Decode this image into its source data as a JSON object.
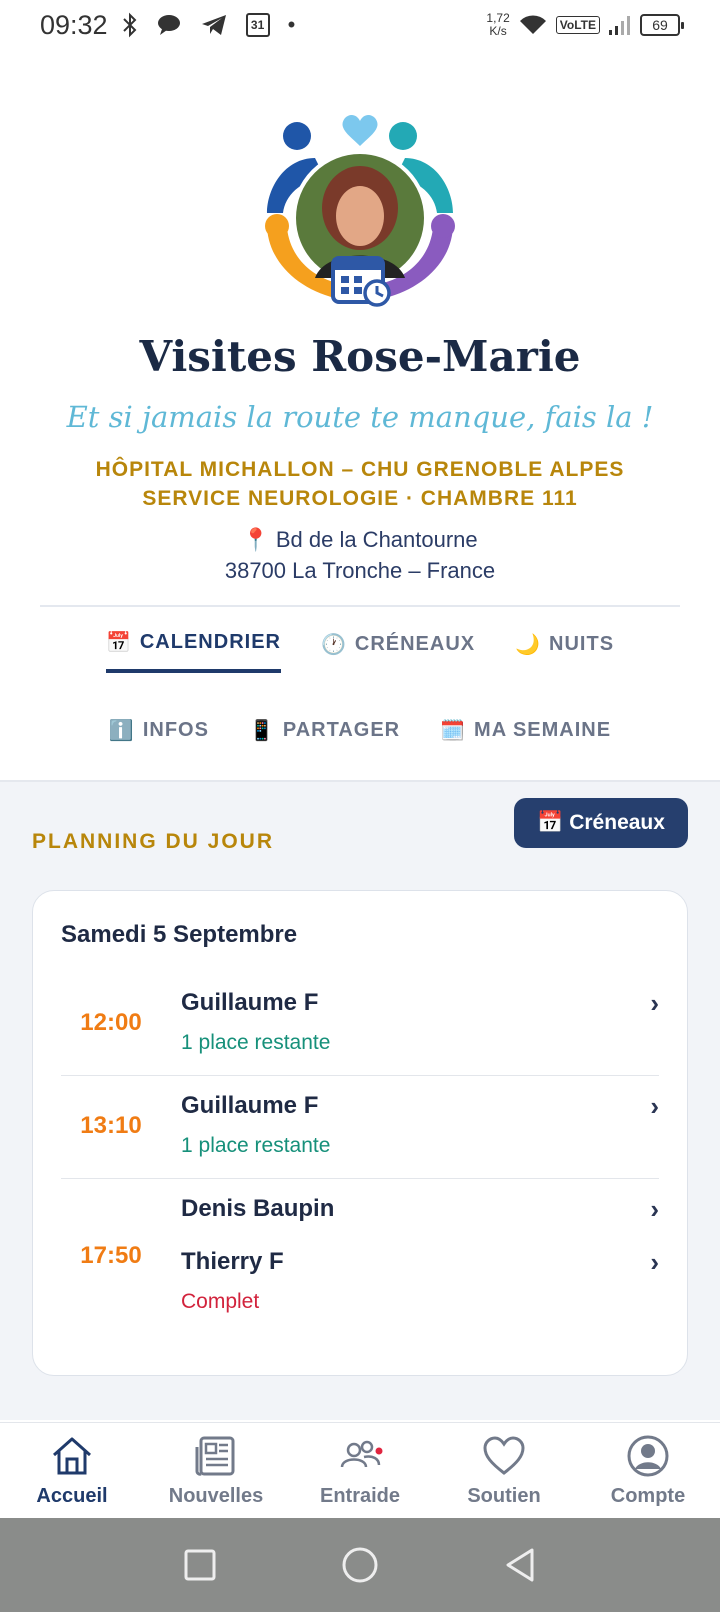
{
  "status_bar": {
    "time": "09:32",
    "icons": [
      "bluetooth-icon",
      "chat-icon",
      "telegram-icon",
      "calendar-icon"
    ],
    "calendar_day": "31",
    "dot": "•",
    "speed_value": "1,72",
    "speed_unit": "K/s",
    "volte": "VoLTE",
    "battery": "69"
  },
  "header": {
    "title": "Visites Rose-Marie",
    "tagline": "Et si jamais la route te manque, fais la !",
    "hospital_line1": "HÔPITAL MICHALLON – CHU GRENOBLE ALPES",
    "hospital_line2": "SERVICE NEUROLOGIE · CHAMBRE 111",
    "address_pin": "📍",
    "address_line1": "Bd de la Chantourne",
    "address_line2": "38700 La Tronche – France"
  },
  "tabs": {
    "row1": [
      {
        "emoji": "📅",
        "label": "CALENDRIER",
        "active": true
      },
      {
        "emoji": "🕐",
        "label": "CRÉNEAUX",
        "active": false
      },
      {
        "emoji": "🌙",
        "label": "NUITS",
        "active": false
      }
    ],
    "row2": [
      {
        "emoji": "ℹ️",
        "label": "INFOS",
        "active": false
      },
      {
        "emoji": "📱",
        "label": "PARTAGER",
        "active": false
      },
      {
        "emoji": "🗓️",
        "label": "MA SEMAINE",
        "active": false
      }
    ]
  },
  "planning": {
    "section_title": "PLANNING DU JOUR",
    "button_emoji": "📅",
    "button_label": "Créneaux",
    "date": "Samedi 5 Septembre",
    "slots": [
      {
        "time": "12:00",
        "visitors": [
          "Guillaume F"
        ],
        "status": "1 place restante",
        "status_type": "ok"
      },
      {
        "time": "13:10",
        "visitors": [
          "Guillaume F"
        ],
        "status": "1 place restante",
        "status_type": "ok"
      },
      {
        "time": "17:50",
        "visitors": [
          "Denis Baupin",
          "Thierry F"
        ],
        "status": "Complet",
        "status_type": "full"
      }
    ],
    "chevron": "›"
  },
  "bottom_nav": [
    {
      "label": "Accueil",
      "icon": "home-icon",
      "active": true
    },
    {
      "label": "Nouvelles",
      "icon": "newspaper-icon",
      "active": false
    },
    {
      "label": "Entraide",
      "icon": "people-icon",
      "active": false,
      "badge": true
    },
    {
      "label": "Soutien",
      "icon": "heart-icon",
      "active": false
    },
    {
      "label": "Compte",
      "icon": "account-icon",
      "active": false
    }
  ],
  "colors": {
    "navy": "#1f3a6b",
    "gold": "#b8860b",
    "teal_tagline": "#5fb8d6",
    "orange_time": "#f07c14",
    "green_status": "#16907a",
    "red_status": "#d2233c"
  }
}
